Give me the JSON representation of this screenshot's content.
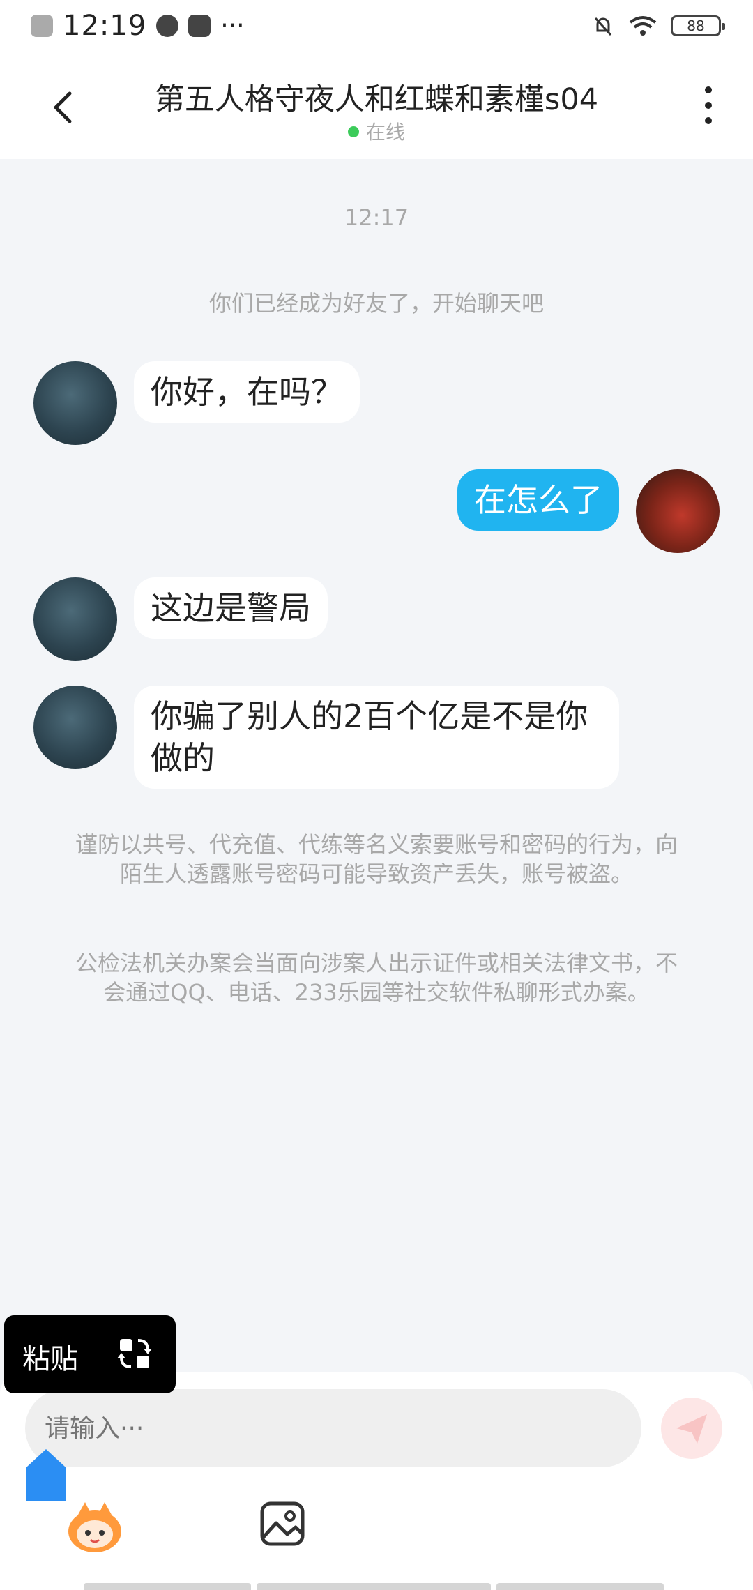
{
  "status_bar": {
    "time": "12:19",
    "battery": "88"
  },
  "header": {
    "title": "第五人格守夜人和红蝶和素槿s04",
    "status": "在线"
  },
  "chat": {
    "timestamp": "12:17",
    "system_message": "你们已经成为好友了，开始聊天吧",
    "messages": [
      {
        "from": "other",
        "text": "你好，在吗？"
      },
      {
        "from": "me",
        "text": "在怎么了"
      },
      {
        "from": "other",
        "text": "这边是警局"
      },
      {
        "from": "other",
        "text": "你骗了别人的2百个亿是不是你做的"
      }
    ],
    "warning_1": "谨防以共号、代充值、代练等名义索要账号和密码的行为，向陌生人透露账号密码可能导致资产丢失，账号被盗。",
    "warning_2": "公检法机关办案会当面向涉案人出示证件或相关法律文书，不会通过QQ、电话、233乐园等社交软件私聊形式办案。"
  },
  "paste_popup": {
    "label": "粘贴"
  },
  "input_bar": {
    "placeholder": "请输入···"
  },
  "colors": {
    "outgoing_bubble": "#20b4f0",
    "online_dot": "#3ccb5a",
    "send_button": "#fde6e6",
    "background": "#f3f5f8"
  }
}
